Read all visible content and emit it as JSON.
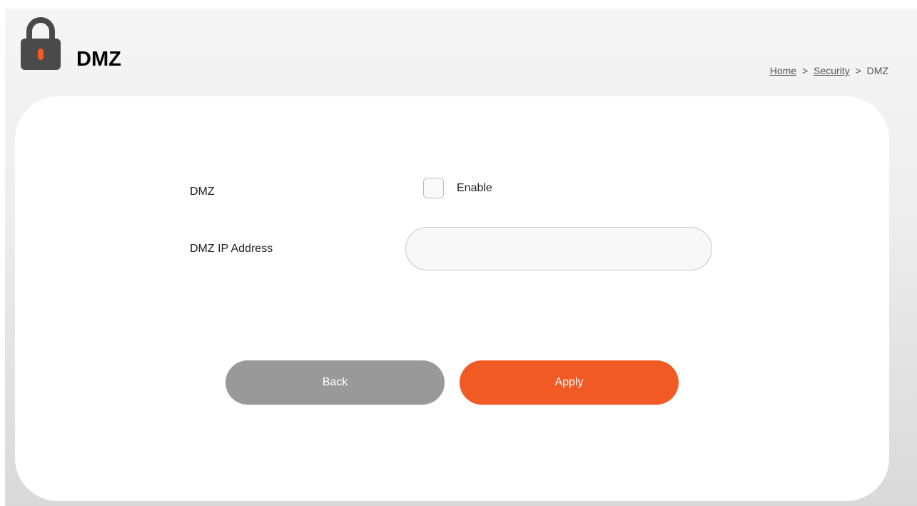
{
  "header": {
    "title": "DMZ",
    "icon": "lock-icon",
    "breadcrumb": {
      "home": "Home",
      "sep1": ">",
      "security": "Security",
      "sep2": ">",
      "current": "DMZ"
    }
  },
  "form": {
    "dmz_label": "DMZ",
    "enable_label": "Enable",
    "enable_checked": false,
    "ip_label": "DMZ IP Address",
    "ip_value": ""
  },
  "buttons": {
    "back_label": "Back",
    "apply_label": "Apply"
  },
  "colors": {
    "accent": "#f15a24",
    "lock_body": "#4a4a4a",
    "lock_keyhole": "#f15a24",
    "back_button": "#999999"
  }
}
